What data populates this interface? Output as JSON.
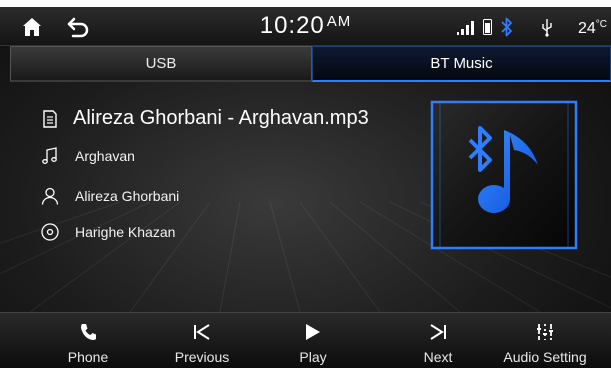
{
  "status_bar": {
    "time": "10:20",
    "ampm": "AM",
    "temperature": "24",
    "temperature_unit": "°C",
    "icons": [
      "home-icon",
      "back-icon",
      "signal-icon",
      "phone-battery-icon",
      "bluetooth-icon",
      "usb-icon"
    ]
  },
  "tabs": {
    "usb_label": "USB",
    "bt_label": "BT Music",
    "active": "BT Music"
  },
  "track": {
    "file_name": "Alireza Ghorbani - Arghavan.mp3",
    "title": "Arghavan",
    "artist": "Alireza Ghorbani",
    "album": "Harighe Khazan"
  },
  "controls": {
    "phone_label": "Phone",
    "previous_label": "Previous",
    "play_label": "Play",
    "next_label": "Next",
    "audio_setting_label": "Audio Setting"
  },
  "colors": {
    "accent": "#2f7cff",
    "background": "#1c1c1c"
  }
}
